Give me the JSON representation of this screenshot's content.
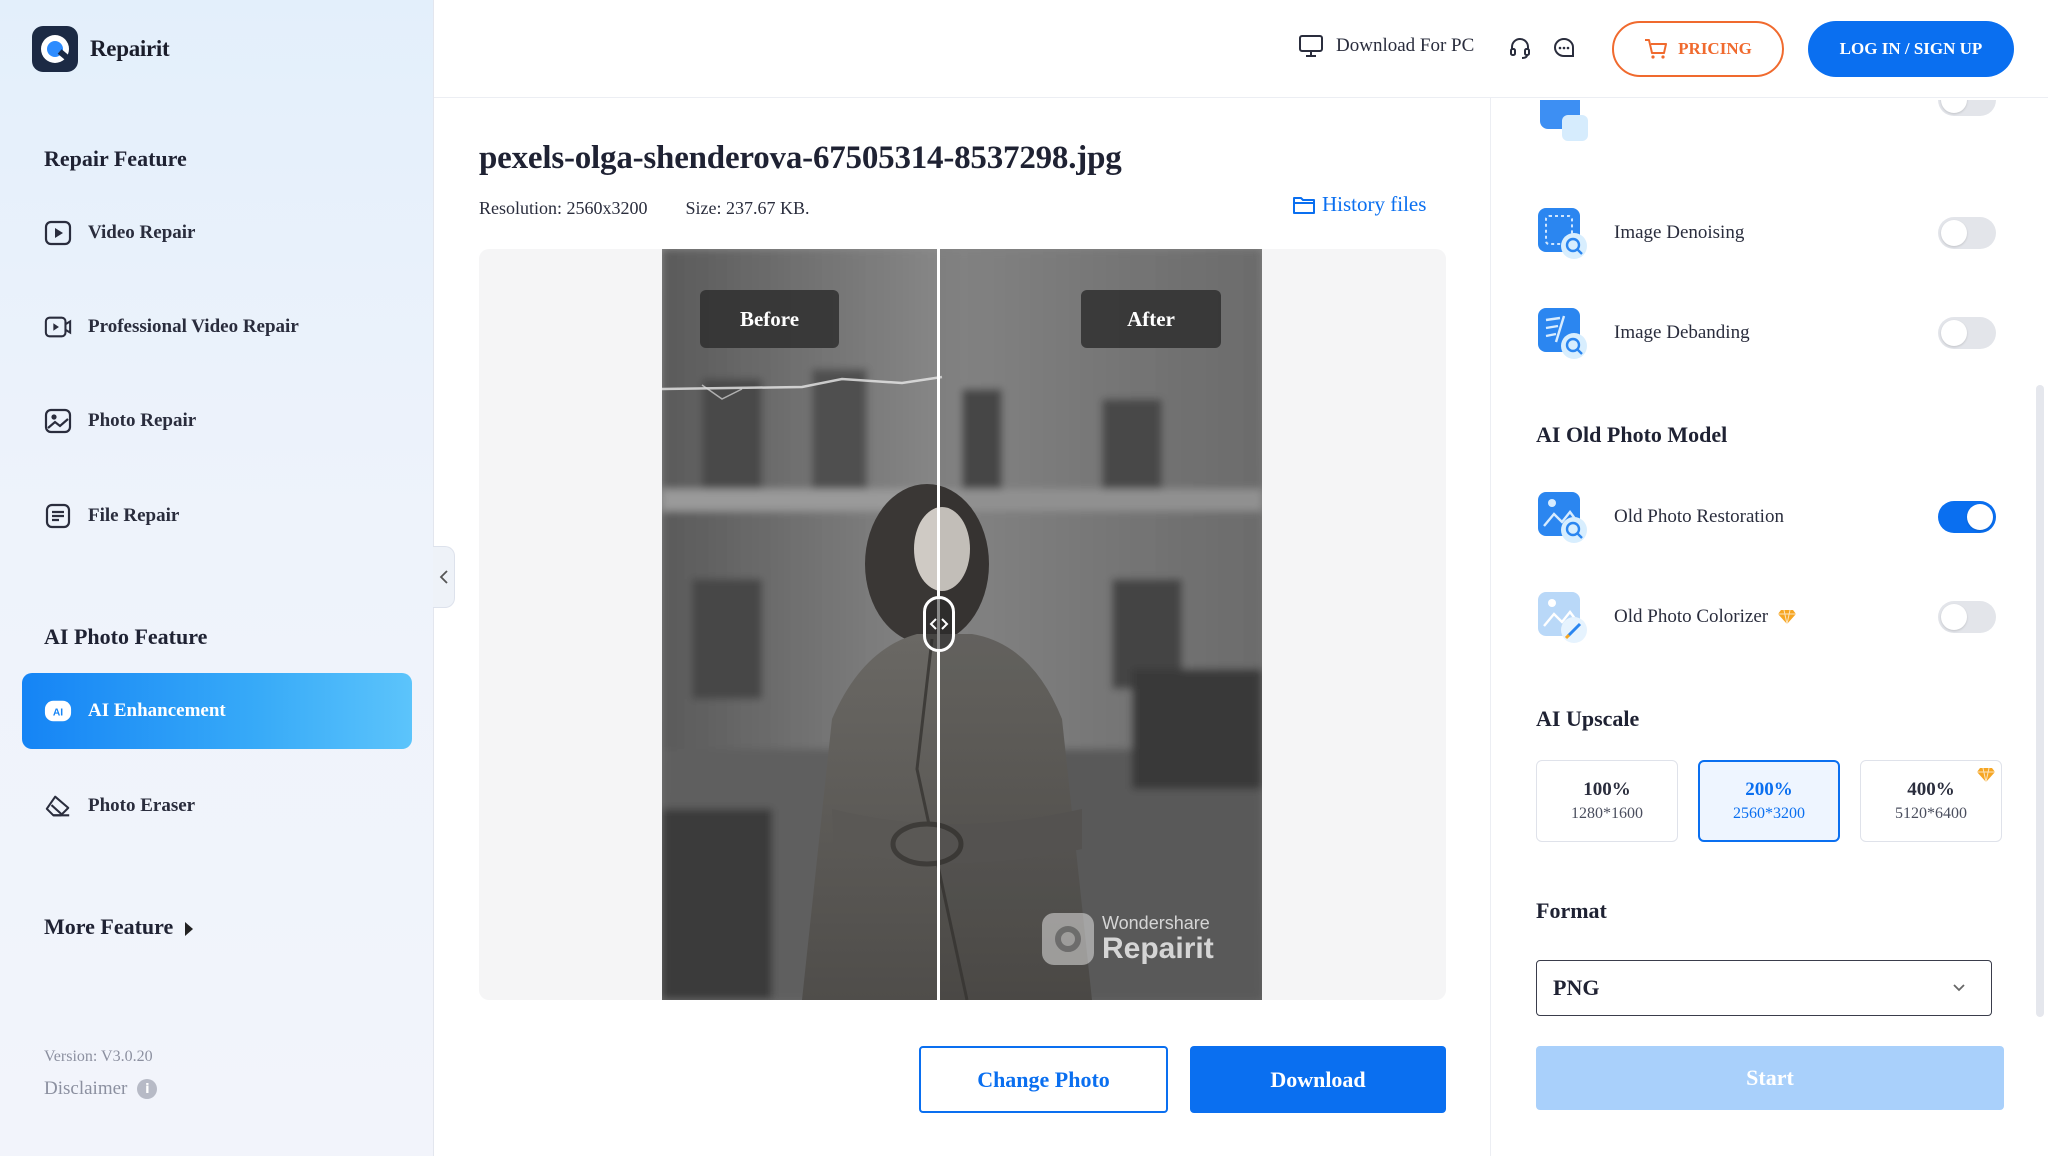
{
  "app": {
    "name": "Repairit"
  },
  "sidebar": {
    "repair_section": "Repair Feature",
    "repair_items": [
      {
        "label": "Video Repair",
        "icon": "video-play-icon"
      },
      {
        "label": "Professional Video Repair",
        "icon": "video-camera-icon"
      },
      {
        "label": "Photo Repair",
        "icon": "photo-icon"
      },
      {
        "label": "File Repair",
        "icon": "file-icon"
      }
    ],
    "ai_section": "AI Photo Feature",
    "ai_items": [
      {
        "label": "AI Enhancement",
        "icon": "ai-badge-icon",
        "active": true
      },
      {
        "label": "Photo Eraser",
        "icon": "eraser-icon",
        "active": false
      }
    ],
    "more_feature": "More Feature",
    "version": "Version: V3.0.20",
    "disclaimer": "Disclaimer"
  },
  "header": {
    "download_pc": "Download For PC",
    "pricing": "PRICING",
    "login": "LOG IN / SIGN UP"
  },
  "file": {
    "name": "pexels-olga-shenderova-67505314-8537298.jpg",
    "resolution": "Resolution: 2560x3200",
    "size": "Size: 237.67 KB.",
    "history": "History files"
  },
  "preview": {
    "before_label": "Before",
    "after_label": "After",
    "watermark_brand": "Wondershare",
    "watermark_product": "Repairit",
    "split_position": 0.46
  },
  "actions": {
    "change_photo": "Change Photo",
    "download": "Download"
  },
  "panel": {
    "toggles": [
      {
        "label": "Image Denoising",
        "on": false,
        "icon": "denoise-icon"
      },
      {
        "label": "Image Debanding",
        "on": false,
        "icon": "deband-icon"
      }
    ],
    "old_photo_title": "AI Old Photo Model",
    "old_photo_toggles": [
      {
        "label": "Old Photo Restoration",
        "on": true,
        "icon": "restore-icon"
      },
      {
        "label": "Old Photo Colorizer",
        "on": false,
        "icon": "colorize-icon",
        "premium": true
      }
    ],
    "upscale_title": "AI Upscale",
    "upscale_options": [
      {
        "pct": "100%",
        "res": "1280*1600",
        "selected": false,
        "premium": false
      },
      {
        "pct": "200%",
        "res": "2560*3200",
        "selected": true,
        "premium": false
      },
      {
        "pct": "400%",
        "res": "5120*6400",
        "selected": false,
        "premium": true
      }
    ],
    "format_title": "Format",
    "format_value": "PNG",
    "start": "Start"
  },
  "colors": {
    "primary": "#0a6ff0",
    "pricing": "#f06a2e",
    "premium_gem": "#f6a623",
    "start_disabled": "#a9d0fb"
  }
}
